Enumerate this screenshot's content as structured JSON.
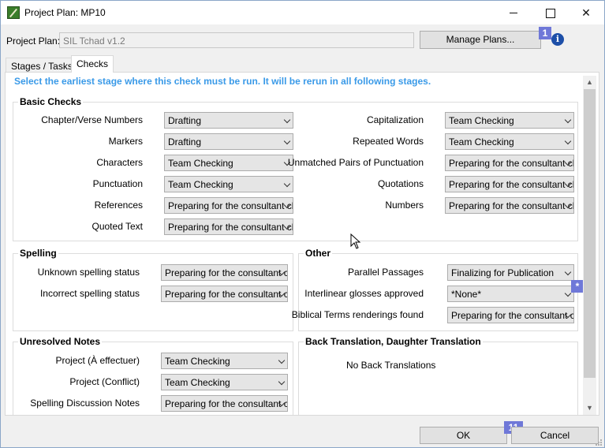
{
  "window": {
    "title": "Project Plan: MP10"
  },
  "plan": {
    "label": "Project Plan:",
    "value": "SIL Tchad v1.2",
    "manage_label": "Manage Plans...",
    "badge": "1"
  },
  "tabs": [
    {
      "label": "Stages / Tasks"
    },
    {
      "label": "Checks"
    }
  ],
  "hint": "Select the earliest stage where this check must be run. It will be rerun in all following stages.",
  "groups": {
    "basic": {
      "title": "Basic Checks",
      "left": [
        {
          "label": "Chapter/Verse Numbers",
          "value": "Drafting"
        },
        {
          "label": "Markers",
          "value": "Drafting"
        },
        {
          "label": "Characters",
          "value": "Team Checking"
        },
        {
          "label": "Punctuation",
          "value": "Team Checking"
        },
        {
          "label": "References",
          "value": "Preparing for the consultant cl"
        },
        {
          "label": "Quoted Text",
          "value": "Preparing for the consultant cl"
        }
      ],
      "right": [
        {
          "label": "Capitalization",
          "value": "Team Checking"
        },
        {
          "label": "Repeated Words",
          "value": "Team Checking"
        },
        {
          "label": "Unmatched Pairs of Punctuation",
          "value": "Preparing for the consultant cl"
        },
        {
          "label": "Quotations",
          "value": "Preparing for the consultant cl"
        },
        {
          "label": "Numbers",
          "value": "Preparing for the consultant cl"
        }
      ]
    },
    "spelling": {
      "title": "Spelling",
      "rows": [
        {
          "label": "Unknown spelling status",
          "value": "Preparing for the consultant c"
        },
        {
          "label": "Incorrect spelling status",
          "value": "Preparing for the consultant c"
        }
      ]
    },
    "other": {
      "title": "Other",
      "rows": [
        {
          "label": "Parallel Passages",
          "value": "Finalizing for Publication"
        },
        {
          "label": "Interlinear glosses approved",
          "value": "*None*"
        },
        {
          "label": "Biblical Terms renderings found",
          "value": "Preparing for the consultant c"
        }
      ],
      "badge": "*"
    },
    "notes": {
      "title": "Unresolved Notes",
      "rows": [
        {
          "label": "Project (À effectuer)",
          "value": "Team Checking"
        },
        {
          "label": "Project (Conflict)",
          "value": "Team Checking"
        },
        {
          "label": "Spelling Discussion Notes",
          "value": "Preparing for the consultant c"
        }
      ]
    },
    "bt": {
      "title": "Back Translation, Daughter Translation",
      "text": "No Back Translations"
    }
  },
  "footer": {
    "ok_label": "OK",
    "cancel_label": "Cancel",
    "badge": "11"
  }
}
